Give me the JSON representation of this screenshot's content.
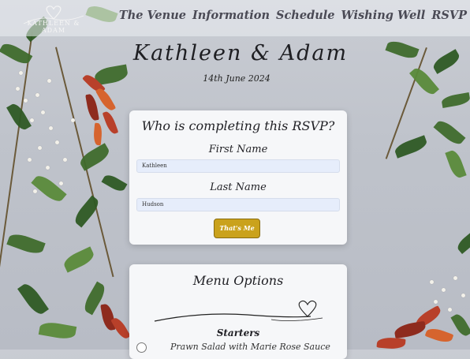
{
  "header": {
    "logo_text": "KATHLEEN & ADAM",
    "nav": [
      "The Venue",
      "Information",
      "Schedule",
      "Wishing Well",
      "RSVP"
    ]
  },
  "hero": {
    "names": "Kathleen & Adam",
    "date": "14th June 2024"
  },
  "rsvp_card": {
    "title": "Who is completing this RSVP?",
    "first_name_label": "First Name",
    "first_name_value": "Kathleen",
    "last_name_label": "Last Name",
    "last_name_value": "Hudson",
    "submit_label": "That's Me"
  },
  "menu_card": {
    "title": "Menu Options",
    "section_label": "Starters",
    "first_option": "Prawn Salad with Marie Rose Sauce"
  },
  "colors": {
    "button": "#caa21c",
    "input_bg": "#e6edfb",
    "nav_text": "#4a4a55"
  }
}
